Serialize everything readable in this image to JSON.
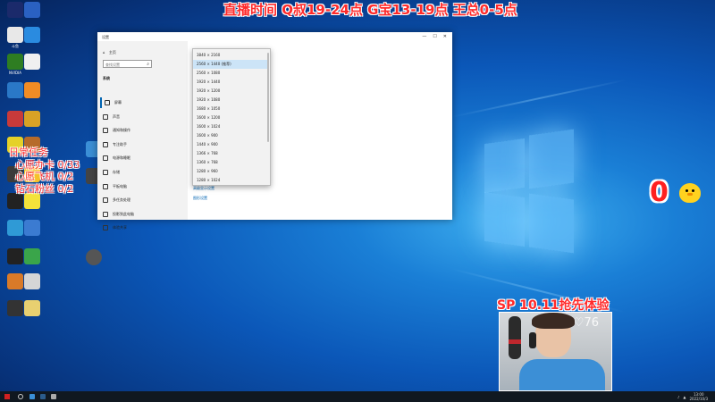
{
  "overlay": {
    "schedule_banner": "直播时间 Q叔19-24点 G宝13-19点 王总0-5点",
    "daily_tasks": "日常任务\n  心愿办卡 0/33\n  心愿飞机 0/2\n  钻石粉丝 0/2",
    "counter": "0",
    "sp_label": "SP 10.11抢先体验",
    "like_count": "76"
  },
  "settings_window": {
    "title": "设置",
    "sidebar": {
      "home": "主页",
      "search_placeholder": "查找设置",
      "section": "系统",
      "items": [
        {
          "label": "屏幕",
          "active": true
        },
        {
          "label": "声音",
          "active": false
        },
        {
          "label": "通知和操作",
          "active": false
        },
        {
          "label": "专注助手",
          "active": false
        },
        {
          "label": "电源和睡眠",
          "active": false
        },
        {
          "label": "存储",
          "active": false
        },
        {
          "label": "平板电脑",
          "active": false
        },
        {
          "label": "多任务处理",
          "active": false
        },
        {
          "label": "投影到此电脑",
          "active": false
        },
        {
          "label": "体验共享",
          "active": false
        }
      ]
    },
    "links": {
      "advanced_display": "高级显示设置",
      "graphics": "图形设置"
    },
    "resolution_dropdown": {
      "options": [
        "3840 × 2160",
        "2560 × 1440 (推荐)",
        "2560 × 1080",
        "1920 × 1440",
        "1920 × 1200",
        "1920 × 1080",
        "1680 × 1050",
        "1600 × 1200",
        "1600 × 1024",
        "1600 × 900",
        "1440 × 900",
        "1366 × 768",
        "1360 × 768",
        "1280 × 960",
        "1280 × 1024"
      ],
      "selected_index": 1
    }
  },
  "desktop_icons": [
    {
      "label": "",
      "color": "#1b2a6b"
    },
    {
      "label": "",
      "color": "#2a61c2"
    },
    {
      "label": "斗鱼",
      "color": "#e8e8e8"
    },
    {
      "label": "",
      "color": "#2a8be0"
    },
    {
      "label": "NVIDIA",
      "color": "#2e7d22"
    },
    {
      "label": "",
      "color": "#f0f0f0"
    },
    {
      "label": "",
      "color": "#2a78c7"
    },
    {
      "label": "",
      "color": "#f08c25"
    },
    {
      "label": "",
      "color": "#c83a3a"
    },
    {
      "label": "",
      "color": "#d8a225"
    },
    {
      "label": "",
      "color": "#e5d128"
    },
    {
      "label": "",
      "color": "#b66b2a"
    },
    {
      "label": "",
      "color": "#3b3b3b"
    },
    {
      "label": "",
      "color": "#f5c22a"
    },
    {
      "label": "",
      "color": "#222222"
    },
    {
      "label": "",
      "color": "#f3e33a"
    },
    {
      "label": "",
      "color": "#2f9ad6"
    },
    {
      "label": "",
      "color": "#3b7bd1"
    },
    {
      "label": "",
      "color": "#222222"
    },
    {
      "label": "",
      "color": "#3aa54a"
    },
    {
      "label": "",
      "color": "#d97a28"
    },
    {
      "label": "",
      "color": "#d6d6d6"
    },
    {
      "label": "",
      "color": "#333333"
    },
    {
      "label": "",
      "color": "#e8d070"
    }
  ],
  "taskbar": {
    "time": "13:00",
    "date": "2022/10/3"
  },
  "colors": {
    "accent": "#0063b1",
    "overlay_red": "#ff2a2a",
    "taskbar": "#101820"
  }
}
